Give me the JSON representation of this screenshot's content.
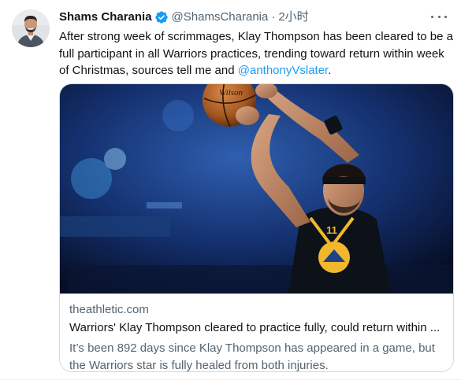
{
  "author": {
    "name": "Shams Charania",
    "handle": "@ShamsCharania",
    "separator": "·",
    "time": "2小时",
    "verified": true
  },
  "tweet": {
    "text": "After strong week of scrimmages, Klay Thompson has been cleared to be a full participant in all Warriors practices, trending toward return within week of Christmas, sources tell me and ",
    "mention": "@anthonyVslater",
    "text_end": "."
  },
  "card": {
    "domain": "theathletic.com",
    "title": "Warriors' Klay Thompson cleared to practice fully, could return within ...",
    "description": "It’s been 892 days since Klay Thompson has appeared in a game, but the Warriors star is fully healed from both injuries.",
    "image": {
      "ball_brand": "Wilson",
      "jersey_number": "11"
    }
  },
  "icons": {
    "verified": "verified-badge-icon",
    "more": "more-options-icon"
  },
  "colors": {
    "accent": "#1d9bf0",
    "secondary_text": "#536471",
    "primary_text": "#0f1419",
    "border": "#cfd9de"
  }
}
